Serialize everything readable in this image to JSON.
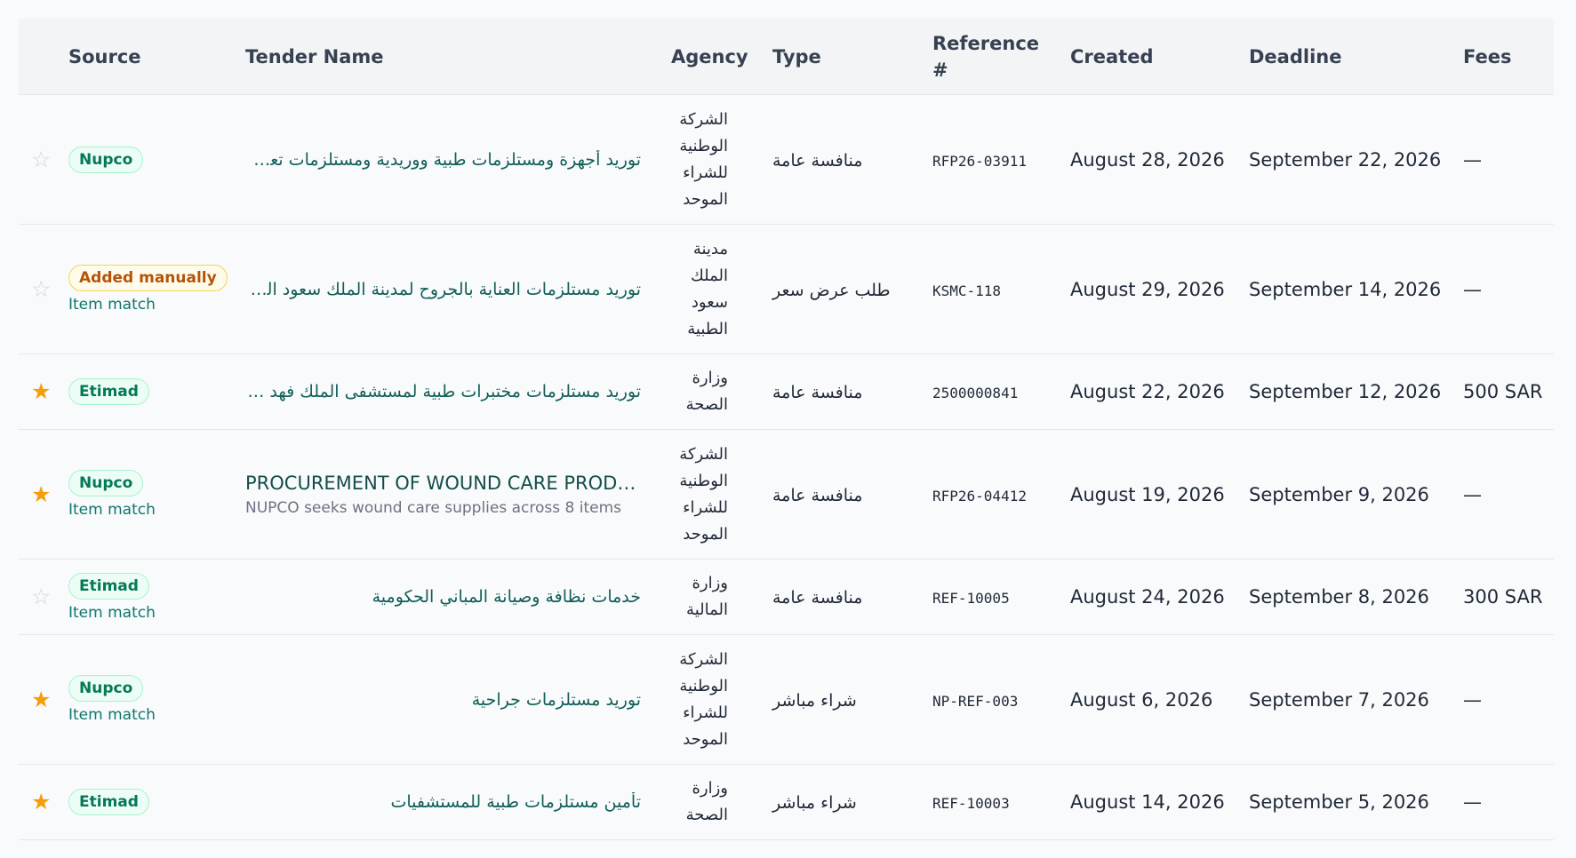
{
  "columns": {
    "source": "Source",
    "tender_name": "Tender Name",
    "agency": "Agency",
    "type": "Type",
    "reference": "Reference #",
    "created": "Created",
    "deadline": "Deadline",
    "fees": "Fees"
  },
  "colors": {
    "star_active": "#f59e0b",
    "star_inactive": "#d1d5db",
    "badge_green": "#047857",
    "badge_orange": "#b45309",
    "link": "#115e59"
  },
  "rows": [
    {
      "starred": false,
      "star_icon": "☆",
      "source": "Nupco",
      "source_color": "green",
      "match": "",
      "tender_name": "توريد أجهزة ومستلزمات طبية ووريدية ومستلزمات تعقيم للمستشفيات المركزية",
      "description": "",
      "agency": "الشركة الوطنية للشراء الموحد",
      "type": "منافسة عامة",
      "reference": "RFP26-03911",
      "created": "August 28, 2026",
      "deadline": "September 22, 2026",
      "fees": "—"
    },
    {
      "starred": false,
      "star_icon": "☆",
      "source": "Added manually",
      "source_color": "orange",
      "match": "Item match",
      "tender_name": "توريد مستلزمات العناية بالجروح لمدينة الملك سعود الطبية",
      "description": "",
      "agency": "مدينة الملك سعود الطبية",
      "type": "طلب عرض سعر",
      "reference": "KSMC-118",
      "created": "August 29, 2026",
      "deadline": "September 14, 2026",
      "fees": "—"
    },
    {
      "starred": true,
      "star_icon": "★",
      "source": "Etimad",
      "source_color": "green",
      "match": "",
      "tender_name": "توريد مستلزمات مختبرات طبية لمستشفى الملك فهد بجدة",
      "description": "",
      "agency": "وزارة الصحة",
      "type": "منافسة عامة",
      "reference": "2500000841",
      "created": "August 22, 2026",
      "deadline": "September 12, 2026",
      "fees": "500 SAR"
    },
    {
      "starred": true,
      "star_icon": "★",
      "source": "Nupco",
      "source_color": "green",
      "match": "Item match",
      "tender_name": "PROCUREMENT OF WOUND CARE PRODUCTS",
      "description": "NUPCO seeks wound care supplies across 8 items",
      "agency": "الشركة الوطنية للشراء الموحد",
      "type": "منافسة عامة",
      "reference": "RFP26-04412",
      "created": "August 19, 2026",
      "deadline": "September 9, 2026",
      "fees": "—"
    },
    {
      "starred": false,
      "star_icon": "☆",
      "source": "Etimad",
      "source_color": "green",
      "match": "Item match",
      "tender_name": "خدمات نظافة وصيانة المباني الحكومية",
      "description": "",
      "agency": "وزارة المالية",
      "type": "منافسة عامة",
      "reference": "REF-10005",
      "created": "August 24, 2026",
      "deadline": "September 8, 2026",
      "fees": "300 SAR"
    },
    {
      "starred": true,
      "star_icon": "★",
      "source": "Nupco",
      "source_color": "green",
      "match": "Item match",
      "tender_name": "توريد مستلزمات جراحية",
      "description": "",
      "agency": "الشركة الوطنية للشراء الموحد",
      "type": "شراء مباشر",
      "reference": "NP-REF-003",
      "created": "August 6, 2026",
      "deadline": "September 7, 2026",
      "fees": "—"
    },
    {
      "starred": true,
      "star_icon": "★",
      "source": "Etimad",
      "source_color": "green",
      "match": "",
      "tender_name": "تأمين مستلزمات طبية للمستشفيات",
      "description": "",
      "agency": "وزارة الصحة",
      "type": "شراء مباشر",
      "reference": "REF-10003",
      "created": "August 14, 2026",
      "deadline": "September 5, 2026",
      "fees": "—"
    }
  ]
}
